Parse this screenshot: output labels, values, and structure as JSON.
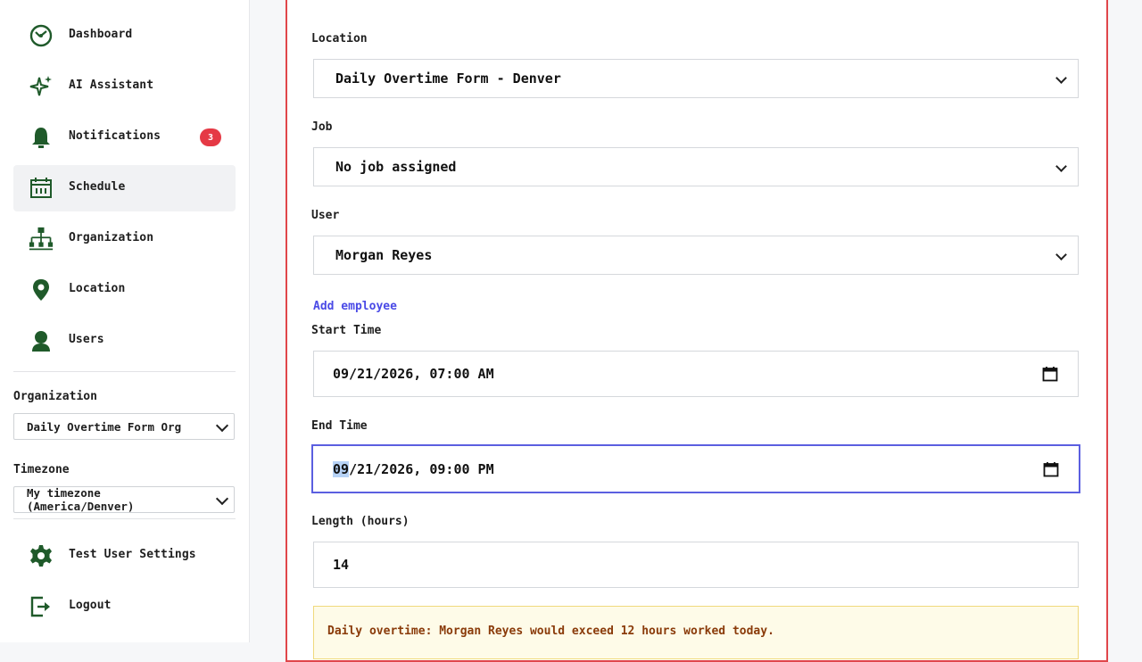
{
  "sidebar": {
    "items": [
      {
        "label": "Dashboard",
        "icon": "dashboard-icon"
      },
      {
        "label": "AI Assistant",
        "icon": "sparkle-icon"
      },
      {
        "label": "Notifications",
        "icon": "bell-icon",
        "badge": "3"
      },
      {
        "label": "Schedule",
        "icon": "calendar-icon",
        "active": true
      },
      {
        "label": "Organization",
        "icon": "org-chart-icon"
      },
      {
        "label": "Location",
        "icon": "map-pin-icon"
      },
      {
        "label": "Users",
        "icon": "user-icon"
      }
    ],
    "organization_label": "Organization",
    "organization_value": "Daily Overtime Form Org",
    "timezone_label": "Timezone",
    "timezone_value": "My timezone (America/Denver)",
    "settings_label": "Test User Settings",
    "logout_label": "Logout"
  },
  "form": {
    "location_label": "Location",
    "location_value": "Daily Overtime Form - Denver",
    "job_label": "Job",
    "job_value": "No job assigned",
    "user_label": "User",
    "user_value": "Morgan Reyes",
    "add_employee_link": "Add employee",
    "start_label": "Start Time",
    "start_value": "09/21/2026, 07:00 AM",
    "end_label": "End Time",
    "end_value_selected": "09",
    "end_value_rest": "/21/2026, 09:00 PM",
    "length_label": "Length (hours)",
    "length_value": "14",
    "warning": "Daily overtime: Morgan Reyes would exceed 12 hours worked today."
  },
  "colors": {
    "icon_green": "#1f5a2a",
    "badge_red": "#e53945",
    "panel_border": "#e0464b",
    "link": "#4a4ae6",
    "focus": "#5b5fe0",
    "warning_bg": "#fefbe8",
    "warning_text": "#8a3b0a"
  }
}
